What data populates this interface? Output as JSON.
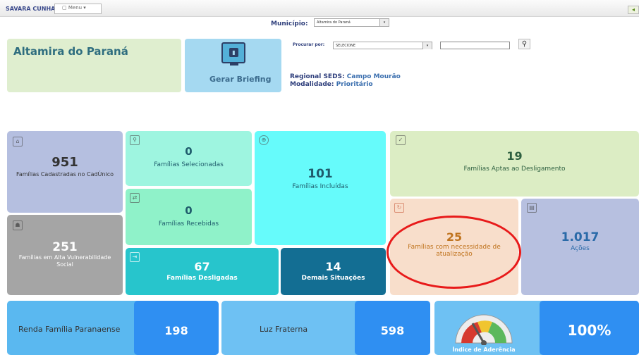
{
  "header": {
    "user": "SAVARA CUNHA",
    "menu_label": "Menu",
    "back_icon": "arrow-left-icon"
  },
  "municipio": {
    "label": "Município:",
    "value": "Altamira do Paraná"
  },
  "city": {
    "name": "Altamira do Paraná"
  },
  "briefing": {
    "label": "Gerar Briefing",
    "icon": "monitor-chart-icon"
  },
  "search": {
    "label": "Procurar por:",
    "select_value": "SELECIONE",
    "input_value": ""
  },
  "regional": {
    "regional_label": "Regional SEDS:",
    "regional_value": "Campo Mourão",
    "modalidade_label": "Modalidade:",
    "modalidade_value": "Prioritário"
  },
  "tiles": {
    "cadastradas": {
      "value": "951",
      "label": "Famílias Cadastradas no CadÚnico"
    },
    "alta_vulnerabilidade": {
      "value": "251",
      "label": "Famílias em Alta Vulnerabilidade Social"
    },
    "selecionadas": {
      "value": "0",
      "label": "Famílias Selecionadas"
    },
    "recebidas": {
      "value": "0",
      "label": "Famílias Recebidas"
    },
    "incluidas": {
      "value": "101",
      "label": "Famílias Incluídas"
    },
    "desligadas": {
      "value": "67",
      "label": "Famílias Desligadas"
    },
    "demais": {
      "value": "14",
      "label": "Demais Situações"
    },
    "aptas": {
      "value": "19",
      "label": "Famílias Aptas ao Desligamento"
    },
    "atualizacao": {
      "value": "25",
      "label": "Famílias com necessidade de atualização"
    },
    "acoes": {
      "value": "1.017",
      "label": "Ações"
    }
  },
  "bottom": {
    "renda": {
      "label": "Renda Família Paranaense",
      "value": "198"
    },
    "luz": {
      "label": "Luz Fraterna",
      "value": "598"
    },
    "indice": {
      "label": "Índice de Aderência",
      "value": "100%"
    }
  },
  "colors": {
    "highlight": "#e81a1a",
    "accent": "#2f8ff2"
  }
}
